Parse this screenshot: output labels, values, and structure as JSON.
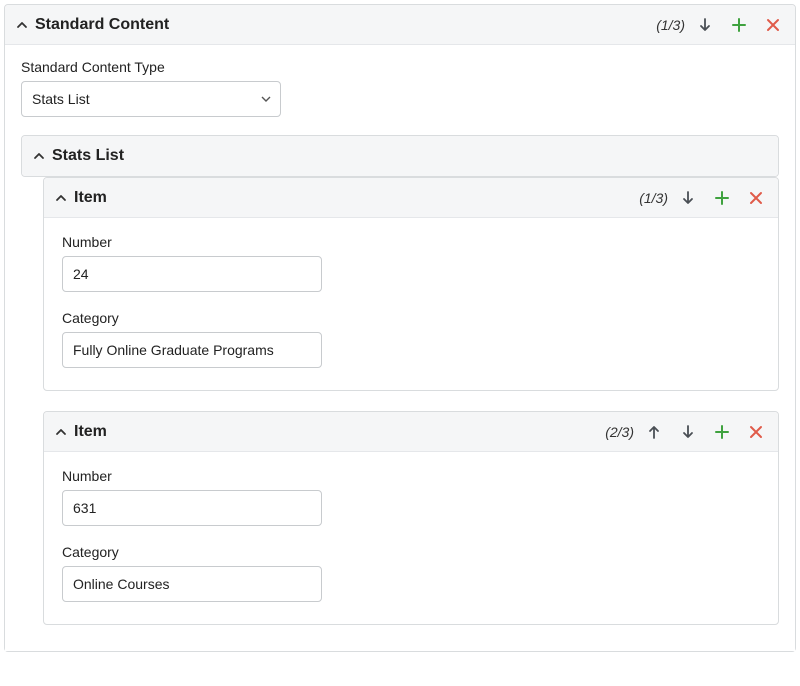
{
  "standardContent": {
    "title": "Standard Content",
    "count": "(1/3)",
    "typeLabel": "Standard Content Type",
    "typeValue": "Stats List"
  },
  "statsList": {
    "title": "Stats List"
  },
  "items": [
    {
      "title": "Item",
      "count": "(1/3)",
      "numberLabel": "Number",
      "numberValue": "24",
      "categoryLabel": "Category",
      "categoryValue": "Fully Online Graduate Programs",
      "showUp": false,
      "showDown": true
    },
    {
      "title": "Item",
      "count": "(2/3)",
      "numberLabel": "Number",
      "numberValue": "631",
      "categoryLabel": "Category",
      "categoryValue": "Online Courses",
      "showUp": true,
      "showDown": true
    }
  ],
  "colors": {
    "add": "#3fa23f",
    "remove": "#e05b4a",
    "arrow": "#4a4f55",
    "chev": "#333"
  }
}
